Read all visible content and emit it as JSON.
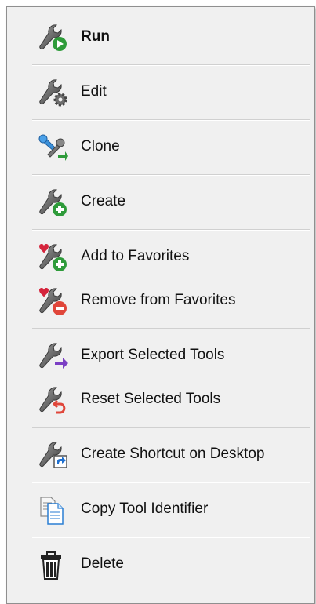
{
  "menu": {
    "run": {
      "label": "Run",
      "icon": "wrench-run-icon"
    },
    "edit": {
      "label": "Edit",
      "icon": "wrench-gear-icon"
    },
    "clone": {
      "label": "Clone",
      "icon": "wrench-clone-icon"
    },
    "create": {
      "label": "Create",
      "icon": "wrench-add-icon"
    },
    "add_favorites": {
      "label": "Add to Favorites",
      "icon": "favorite-add-icon"
    },
    "remove_favorites": {
      "label": "Remove from Favorites",
      "icon": "favorite-remove-icon"
    },
    "export_tools": {
      "label": "Export Selected Tools",
      "icon": "wrench-export-icon"
    },
    "reset_tools": {
      "label": "Reset Selected Tools",
      "icon": "wrench-reset-icon"
    },
    "create_shortcut": {
      "label": "Create Shortcut on Desktop",
      "icon": "wrench-shortcut-icon"
    },
    "copy_identifier": {
      "label": "Copy Tool Identifier",
      "icon": "copy-document-icon"
    },
    "delete": {
      "label": "Delete",
      "icon": "trash-icon"
    }
  },
  "colors": {
    "green": "#2e9b3a",
    "red": "#e0463a",
    "heart": "#d5243c",
    "purple": "#7b3fc4",
    "blue": "#1e6fcf",
    "wrench": "#6b6b6b"
  }
}
